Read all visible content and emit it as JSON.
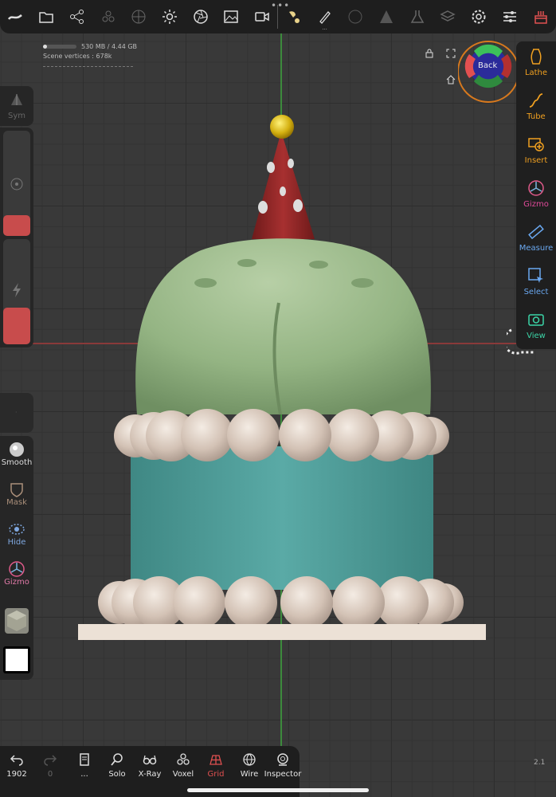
{
  "stats": {
    "memory": "530 MB / 4.44 GB",
    "vertices": "Scene vertices : 678k",
    "memory_used_fraction": 0.12
  },
  "top_toolbar": {
    "icons": [
      "brush-stroke-icon",
      "folder-icon",
      "scene-tree-icon",
      "layers-pyramid-icon",
      "material-sphere-icon",
      "sun-icon",
      "aperture-icon",
      "image-icon",
      "camera-icon",
      "paint-brush-icon",
      "pen-icon",
      "sculpt-sphere-icon",
      "warning-triangle-icon",
      "flask-icon",
      "layers-stack-icon",
      "settings-gear-icon",
      "sliders-icon",
      "cake-icon"
    ],
    "pen_sub": "..."
  },
  "navigation": {
    "gizmo_label": "Back"
  },
  "left_panel": {
    "sym_label": "Sym",
    "tools": [
      {
        "label": "Smooth",
        "icon": "smooth-sphere-icon"
      },
      {
        "label": "Mask",
        "icon": "mask-icon"
      },
      {
        "label": "Hide",
        "icon": "hide-icon"
      },
      {
        "label": "Gizmo",
        "icon": "gizmo-icon"
      }
    ],
    "radius_slider_fraction": 0.2,
    "intensity_slider_fraction": 0.35,
    "color_swatch": "#ffffff"
  },
  "right_panel": {
    "tools": [
      {
        "label": "Lathe",
        "icon": "lathe-icon",
        "color": "#f0a020"
      },
      {
        "label": "Tube",
        "icon": "tube-icon",
        "color": "#f0a020"
      },
      {
        "label": "Insert",
        "icon": "insert-icon",
        "color": "#f0a020"
      },
      {
        "label": "Gizmo",
        "icon": "gizmo-icon",
        "color": "#e04a9a"
      },
      {
        "label": "Measure",
        "icon": "measure-icon",
        "color": "#6aa8f0"
      },
      {
        "label": "Select",
        "icon": "select-icon",
        "color": "#6aa8f0"
      },
      {
        "label": "View",
        "icon": "view-camera-icon",
        "color": "#3cd6a8"
      }
    ]
  },
  "bottom_toolbar": {
    "undo_count": "1902",
    "redo_count": "0",
    "more_label": "...",
    "buttons": [
      {
        "label": "Solo",
        "icon": "search-icon"
      },
      {
        "label": "X-Ray",
        "icon": "xray-glasses-icon"
      },
      {
        "label": "Voxel",
        "icon": "voxel-icon"
      },
      {
        "label": "Grid",
        "icon": "grid-icon",
        "active": true
      },
      {
        "label": "Wire",
        "icon": "wire-icon"
      },
      {
        "label": "Inspector",
        "icon": "inspector-icon"
      }
    ]
  },
  "version": "2.1",
  "colors": {
    "accent_orange": "#f0a020",
    "active_red": "#e05050",
    "cake_green": "#8fae7e",
    "cake_teal": "#4f9e9a",
    "pearl": "#d6c5b8",
    "plate": "#ece1d6"
  }
}
